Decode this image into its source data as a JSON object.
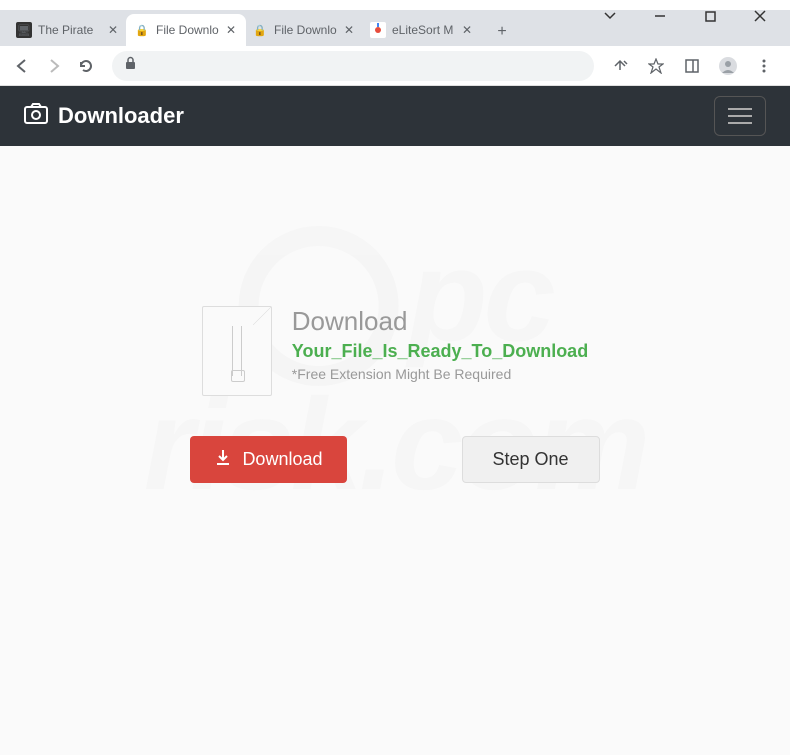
{
  "window": {
    "tabs": [
      {
        "title": "The Pirate",
        "active": false,
        "favicon_bg": "#333"
      },
      {
        "title": "File Downlo",
        "active": true,
        "favicon_bg": "#f0c040"
      },
      {
        "title": "File Downlo",
        "active": false,
        "favicon_bg": "#f0c040"
      },
      {
        "title": "eLiteSort M",
        "active": false,
        "favicon_bg": "#4285f4"
      }
    ]
  },
  "header": {
    "brand": "Downloader"
  },
  "content": {
    "heading": "Download",
    "filename": "Your_File_Is_Ready_To_Download",
    "note": "*Free Extension Might Be Required",
    "download_button": "Download",
    "step_button": "Step One"
  },
  "watermark": {
    "line1": "pc",
    "line2": "risk.com"
  }
}
